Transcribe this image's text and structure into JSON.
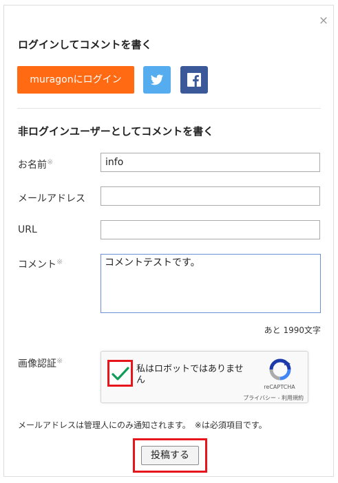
{
  "dialog": {
    "close_glyph": "×"
  },
  "login_section": {
    "title": "ログインしてコメントを書く",
    "muragon_button": "muragonにログイン",
    "twitter_icon": "twitter-icon",
    "facebook_icon": "facebook-icon"
  },
  "guest_section": {
    "title": "非ログインユーザーとしてコメントを書く"
  },
  "form": {
    "name_label": "お名前",
    "name_value": "info",
    "email_label": "メールアドレス",
    "email_value": "",
    "url_label": "URL",
    "url_value": "",
    "comment_label": "コメント",
    "comment_value": "コメントテストです。",
    "required_mark": "※",
    "counter": "あと 1990文字",
    "captcha_label": "画像認証"
  },
  "recaptcha": {
    "label": "私はロボットではありません",
    "checked": true,
    "brand": "reCAPTCHA",
    "links": "プライバシー - 利用規約"
  },
  "footer": {
    "note": "メールアドレスは管理人にのみ通知されます。　※は必須項目です。",
    "submit_label": "投稿する"
  },
  "colors": {
    "muragon": "#ff6a13",
    "twitter": "#55acee",
    "facebook": "#3b5998",
    "highlight": "#e8141c",
    "check": "#0f9d58"
  }
}
